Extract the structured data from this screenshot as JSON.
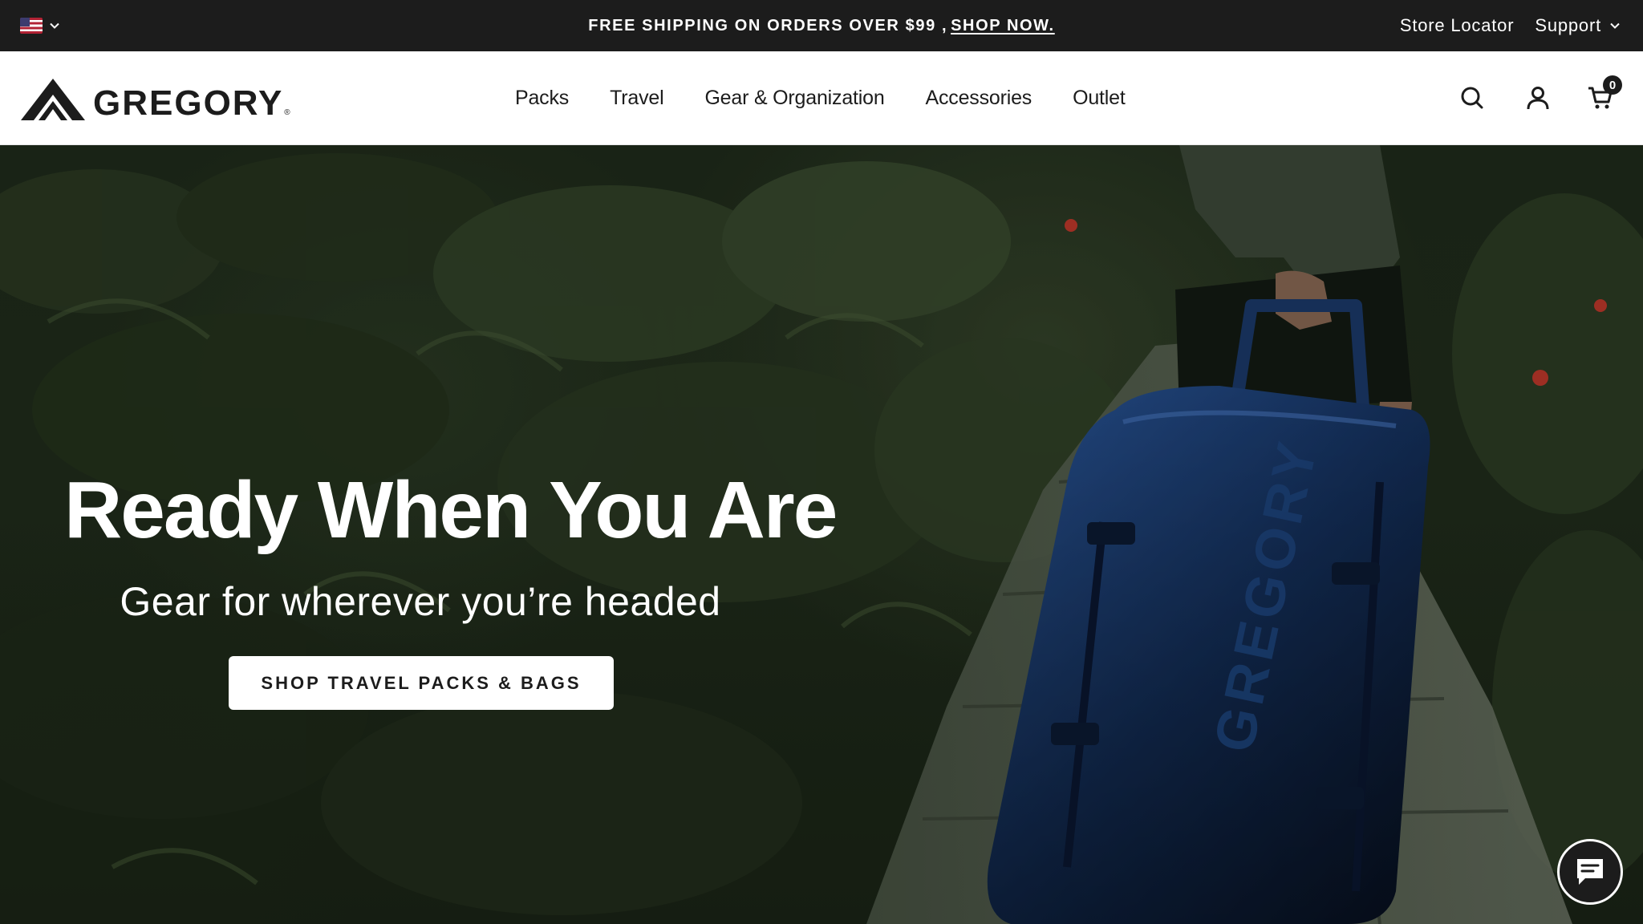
{
  "topbar": {
    "locale_icon": "us-flag-icon",
    "promo_text": "FREE SHIPPING ON ORDERS OVER $99 ,",
    "promo_link": "SHOP NOW.",
    "store_locator": "Store Locator",
    "support": "Support"
  },
  "header": {
    "logo_text": "GREGORY",
    "logo_reg": "®",
    "nav": {
      "packs": "Packs",
      "travel": "Travel",
      "gear": "Gear & Organization",
      "accessories": "Accessories",
      "outlet": "Outlet"
    },
    "icons": {
      "search": "search-icon",
      "account": "user-icon",
      "cart": "cart-icon"
    },
    "cart_count": "0"
  },
  "hero": {
    "title": "Ready When You Are",
    "subtitle": "Gear for wherever you’re headed",
    "cta": "SHOP TRAVEL PACKS & BAGS",
    "bag_brand": "GREGORY"
  },
  "chat": {
    "icon": "chat-icon"
  },
  "colors": {
    "topbar_bg": "#1c1c1c",
    "header_bg": "#ffffff",
    "text_dark": "#1c1c1c",
    "hero_foliage": "#1f2b1b",
    "bag_blue": "#1d3f78"
  }
}
